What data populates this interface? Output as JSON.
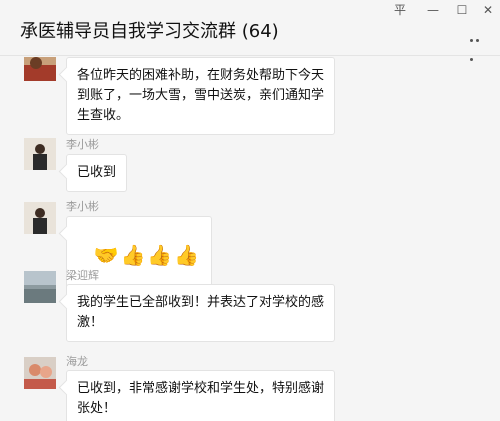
{
  "window": {
    "title": "承医辅导员自我学习交流群 (64)",
    "controls": {
      "pin": "平",
      "minimize": "—",
      "maximize": "☐",
      "close": "✕"
    }
  },
  "messages": [
    {
      "sender": "",
      "text": "各位昨天的困难补助，在财务处帮助下今天\n到账了，一场大雪，雪中送炭，亲们通知学\n生查收。"
    },
    {
      "sender": "李小彬",
      "text": "已收到"
    },
    {
      "sender": "李小彬",
      "emojis": [
        "🤝",
        "👍",
        "👍",
        "👍"
      ]
    },
    {
      "sender": "梁迎辉",
      "text": "我的学生已全部收到！并表达了对学校的感\n激！"
    },
    {
      "sender": "海龙",
      "text": "已收到，非常感谢学校和学生处，特别感谢\n张处！"
    }
  ]
}
